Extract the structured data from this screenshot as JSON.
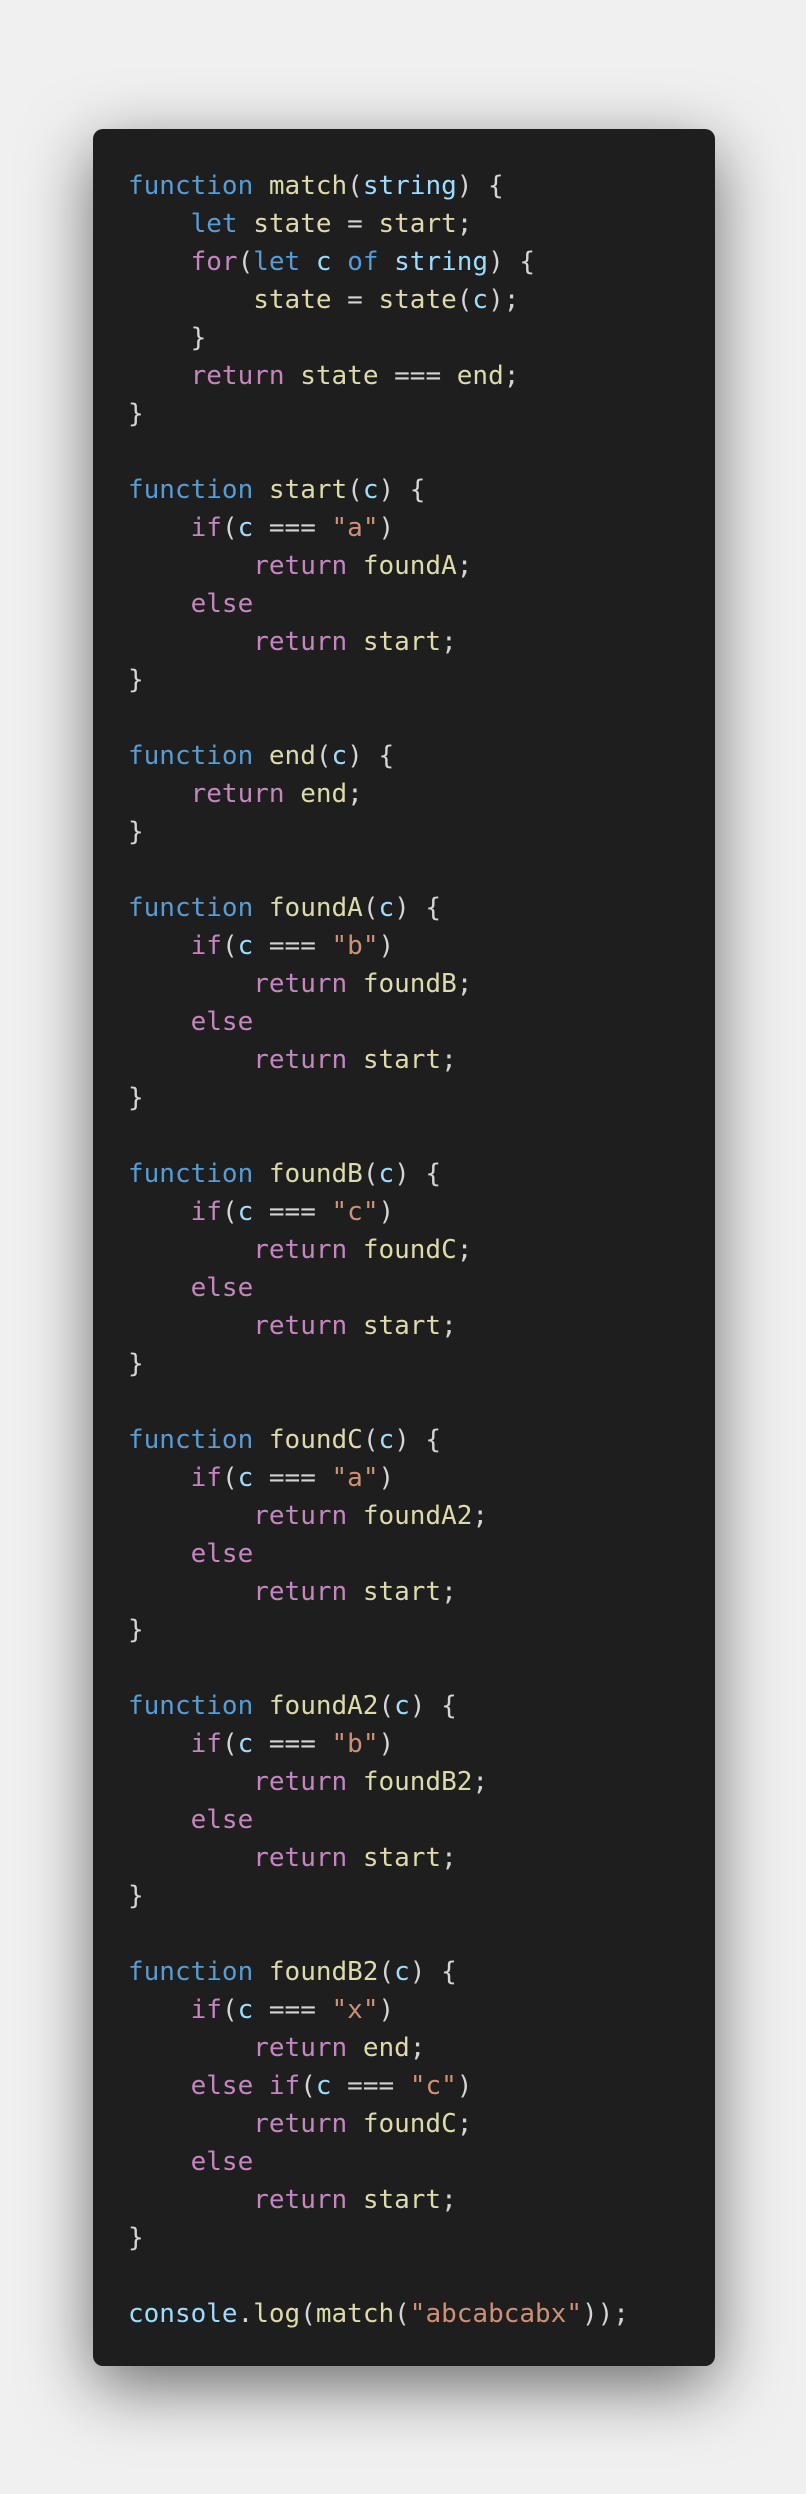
{
  "colors": {
    "background": "#f0f0f0",
    "editor_background": "#1e1e1e",
    "keyword": "#569cd6",
    "control": "#c586c0",
    "function": "#dcdcaa",
    "variable": "#9cdcfe",
    "string": "#ce9178",
    "punctuation": "#d4d4d4"
  },
  "code": {
    "lines": [
      [
        {
          "t": "function",
          "c": "kw"
        },
        {
          "t": " ",
          "c": "pun"
        },
        {
          "t": "match",
          "c": "fn"
        },
        {
          "t": "(",
          "c": "pun"
        },
        {
          "t": "string",
          "c": "var"
        },
        {
          "t": ") {",
          "c": "pun"
        }
      ],
      [
        {
          "t": "    ",
          "c": "pun"
        },
        {
          "t": "let",
          "c": "kw"
        },
        {
          "t": " ",
          "c": "pun"
        },
        {
          "t": "state",
          "c": "fn"
        },
        {
          "t": " = ",
          "c": "pun"
        },
        {
          "t": "start",
          "c": "fn"
        },
        {
          "t": ";",
          "c": "pun"
        }
      ],
      [
        {
          "t": "    ",
          "c": "pun"
        },
        {
          "t": "for",
          "c": "ctl"
        },
        {
          "t": "(",
          "c": "pun"
        },
        {
          "t": "let",
          "c": "kw"
        },
        {
          "t": " ",
          "c": "pun"
        },
        {
          "t": "c",
          "c": "var"
        },
        {
          "t": " ",
          "c": "pun"
        },
        {
          "t": "of",
          "c": "kw"
        },
        {
          "t": " ",
          "c": "pun"
        },
        {
          "t": "string",
          "c": "var"
        },
        {
          "t": ") {",
          "c": "pun"
        }
      ],
      [
        {
          "t": "        ",
          "c": "pun"
        },
        {
          "t": "state",
          "c": "fn"
        },
        {
          "t": " = ",
          "c": "pun"
        },
        {
          "t": "state",
          "c": "fn"
        },
        {
          "t": "(",
          "c": "pun"
        },
        {
          "t": "c",
          "c": "var"
        },
        {
          "t": ");",
          "c": "pun"
        }
      ],
      [
        {
          "t": "    }",
          "c": "pun"
        }
      ],
      [
        {
          "t": "    ",
          "c": "pun"
        },
        {
          "t": "return",
          "c": "ctl"
        },
        {
          "t": " ",
          "c": "pun"
        },
        {
          "t": "state",
          "c": "fn"
        },
        {
          "t": " === ",
          "c": "pun"
        },
        {
          "t": "end",
          "c": "fn"
        },
        {
          "t": ";",
          "c": "pun"
        }
      ],
      [
        {
          "t": "}",
          "c": "pun"
        }
      ],
      [],
      [
        {
          "t": "function",
          "c": "kw"
        },
        {
          "t": " ",
          "c": "pun"
        },
        {
          "t": "start",
          "c": "fn"
        },
        {
          "t": "(",
          "c": "pun"
        },
        {
          "t": "c",
          "c": "var"
        },
        {
          "t": ") {",
          "c": "pun"
        }
      ],
      [
        {
          "t": "    ",
          "c": "pun"
        },
        {
          "t": "if",
          "c": "ctl"
        },
        {
          "t": "(",
          "c": "pun"
        },
        {
          "t": "c",
          "c": "var"
        },
        {
          "t": " === ",
          "c": "pun"
        },
        {
          "t": "\"a\"",
          "c": "str"
        },
        {
          "t": ")",
          "c": "pun"
        }
      ],
      [
        {
          "t": "        ",
          "c": "pun"
        },
        {
          "t": "return",
          "c": "ctl"
        },
        {
          "t": " ",
          "c": "pun"
        },
        {
          "t": "foundA",
          "c": "fn"
        },
        {
          "t": ";",
          "c": "pun"
        }
      ],
      [
        {
          "t": "    ",
          "c": "pun"
        },
        {
          "t": "else",
          "c": "ctl"
        }
      ],
      [
        {
          "t": "        ",
          "c": "pun"
        },
        {
          "t": "return",
          "c": "ctl"
        },
        {
          "t": " ",
          "c": "pun"
        },
        {
          "t": "start",
          "c": "fn"
        },
        {
          "t": ";",
          "c": "pun"
        }
      ],
      [
        {
          "t": "}",
          "c": "pun"
        }
      ],
      [],
      [
        {
          "t": "function",
          "c": "kw"
        },
        {
          "t": " ",
          "c": "pun"
        },
        {
          "t": "end",
          "c": "fn"
        },
        {
          "t": "(",
          "c": "pun"
        },
        {
          "t": "c",
          "c": "var"
        },
        {
          "t": ") {",
          "c": "pun"
        }
      ],
      [
        {
          "t": "    ",
          "c": "pun"
        },
        {
          "t": "return",
          "c": "ctl"
        },
        {
          "t": " ",
          "c": "pun"
        },
        {
          "t": "end",
          "c": "fn"
        },
        {
          "t": ";",
          "c": "pun"
        }
      ],
      [
        {
          "t": "}",
          "c": "pun"
        }
      ],
      [],
      [
        {
          "t": "function",
          "c": "kw"
        },
        {
          "t": " ",
          "c": "pun"
        },
        {
          "t": "foundA",
          "c": "fn"
        },
        {
          "t": "(",
          "c": "pun"
        },
        {
          "t": "c",
          "c": "var"
        },
        {
          "t": ") {",
          "c": "pun"
        }
      ],
      [
        {
          "t": "    ",
          "c": "pun"
        },
        {
          "t": "if",
          "c": "ctl"
        },
        {
          "t": "(",
          "c": "pun"
        },
        {
          "t": "c",
          "c": "var"
        },
        {
          "t": " === ",
          "c": "pun"
        },
        {
          "t": "\"b\"",
          "c": "str"
        },
        {
          "t": ")",
          "c": "pun"
        }
      ],
      [
        {
          "t": "        ",
          "c": "pun"
        },
        {
          "t": "return",
          "c": "ctl"
        },
        {
          "t": " ",
          "c": "pun"
        },
        {
          "t": "foundB",
          "c": "fn"
        },
        {
          "t": ";",
          "c": "pun"
        }
      ],
      [
        {
          "t": "    ",
          "c": "pun"
        },
        {
          "t": "else",
          "c": "ctl"
        }
      ],
      [
        {
          "t": "        ",
          "c": "pun"
        },
        {
          "t": "return",
          "c": "ctl"
        },
        {
          "t": " ",
          "c": "pun"
        },
        {
          "t": "start",
          "c": "fn"
        },
        {
          "t": ";",
          "c": "pun"
        }
      ],
      [
        {
          "t": "}",
          "c": "pun"
        }
      ],
      [],
      [
        {
          "t": "function",
          "c": "kw"
        },
        {
          "t": " ",
          "c": "pun"
        },
        {
          "t": "foundB",
          "c": "fn"
        },
        {
          "t": "(",
          "c": "pun"
        },
        {
          "t": "c",
          "c": "var"
        },
        {
          "t": ") {",
          "c": "pun"
        }
      ],
      [
        {
          "t": "    ",
          "c": "pun"
        },
        {
          "t": "if",
          "c": "ctl"
        },
        {
          "t": "(",
          "c": "pun"
        },
        {
          "t": "c",
          "c": "var"
        },
        {
          "t": " === ",
          "c": "pun"
        },
        {
          "t": "\"c\"",
          "c": "str"
        },
        {
          "t": ")",
          "c": "pun"
        }
      ],
      [
        {
          "t": "        ",
          "c": "pun"
        },
        {
          "t": "return",
          "c": "ctl"
        },
        {
          "t": " ",
          "c": "pun"
        },
        {
          "t": "foundC",
          "c": "fn"
        },
        {
          "t": ";",
          "c": "pun"
        }
      ],
      [
        {
          "t": "    ",
          "c": "pun"
        },
        {
          "t": "else",
          "c": "ctl"
        }
      ],
      [
        {
          "t": "        ",
          "c": "pun"
        },
        {
          "t": "return",
          "c": "ctl"
        },
        {
          "t": " ",
          "c": "pun"
        },
        {
          "t": "start",
          "c": "fn"
        },
        {
          "t": ";",
          "c": "pun"
        }
      ],
      [
        {
          "t": "}",
          "c": "pun"
        }
      ],
      [],
      [
        {
          "t": "function",
          "c": "kw"
        },
        {
          "t": " ",
          "c": "pun"
        },
        {
          "t": "foundC",
          "c": "fn"
        },
        {
          "t": "(",
          "c": "pun"
        },
        {
          "t": "c",
          "c": "var"
        },
        {
          "t": ") {",
          "c": "pun"
        }
      ],
      [
        {
          "t": "    ",
          "c": "pun"
        },
        {
          "t": "if",
          "c": "ctl"
        },
        {
          "t": "(",
          "c": "pun"
        },
        {
          "t": "c",
          "c": "var"
        },
        {
          "t": " === ",
          "c": "pun"
        },
        {
          "t": "\"a\"",
          "c": "str"
        },
        {
          "t": ")",
          "c": "pun"
        }
      ],
      [
        {
          "t": "        ",
          "c": "pun"
        },
        {
          "t": "return",
          "c": "ctl"
        },
        {
          "t": " ",
          "c": "pun"
        },
        {
          "t": "foundA2",
          "c": "fn"
        },
        {
          "t": ";",
          "c": "pun"
        }
      ],
      [
        {
          "t": "    ",
          "c": "pun"
        },
        {
          "t": "else",
          "c": "ctl"
        }
      ],
      [
        {
          "t": "        ",
          "c": "pun"
        },
        {
          "t": "return",
          "c": "ctl"
        },
        {
          "t": " ",
          "c": "pun"
        },
        {
          "t": "start",
          "c": "fn"
        },
        {
          "t": ";",
          "c": "pun"
        }
      ],
      [
        {
          "t": "}",
          "c": "pun"
        }
      ],
      [],
      [
        {
          "t": "function",
          "c": "kw"
        },
        {
          "t": " ",
          "c": "pun"
        },
        {
          "t": "foundA2",
          "c": "fn"
        },
        {
          "t": "(",
          "c": "pun"
        },
        {
          "t": "c",
          "c": "var"
        },
        {
          "t": ") {",
          "c": "pun"
        }
      ],
      [
        {
          "t": "    ",
          "c": "pun"
        },
        {
          "t": "if",
          "c": "ctl"
        },
        {
          "t": "(",
          "c": "pun"
        },
        {
          "t": "c",
          "c": "var"
        },
        {
          "t": " === ",
          "c": "pun"
        },
        {
          "t": "\"b\"",
          "c": "str"
        },
        {
          "t": ")",
          "c": "pun"
        }
      ],
      [
        {
          "t": "        ",
          "c": "pun"
        },
        {
          "t": "return",
          "c": "ctl"
        },
        {
          "t": " ",
          "c": "pun"
        },
        {
          "t": "foundB2",
          "c": "fn"
        },
        {
          "t": ";",
          "c": "pun"
        }
      ],
      [
        {
          "t": "    ",
          "c": "pun"
        },
        {
          "t": "else",
          "c": "ctl"
        }
      ],
      [
        {
          "t": "        ",
          "c": "pun"
        },
        {
          "t": "return",
          "c": "ctl"
        },
        {
          "t": " ",
          "c": "pun"
        },
        {
          "t": "start",
          "c": "fn"
        },
        {
          "t": ";",
          "c": "pun"
        }
      ],
      [
        {
          "t": "}",
          "c": "pun"
        }
      ],
      [],
      [
        {
          "t": "function",
          "c": "kw"
        },
        {
          "t": " ",
          "c": "pun"
        },
        {
          "t": "foundB2",
          "c": "fn"
        },
        {
          "t": "(",
          "c": "pun"
        },
        {
          "t": "c",
          "c": "var"
        },
        {
          "t": ") {",
          "c": "pun"
        }
      ],
      [
        {
          "t": "    ",
          "c": "pun"
        },
        {
          "t": "if",
          "c": "ctl"
        },
        {
          "t": "(",
          "c": "pun"
        },
        {
          "t": "c",
          "c": "var"
        },
        {
          "t": " === ",
          "c": "pun"
        },
        {
          "t": "\"x\"",
          "c": "str"
        },
        {
          "t": ")",
          "c": "pun"
        }
      ],
      [
        {
          "t": "        ",
          "c": "pun"
        },
        {
          "t": "return",
          "c": "ctl"
        },
        {
          "t": " ",
          "c": "pun"
        },
        {
          "t": "end",
          "c": "fn"
        },
        {
          "t": ";",
          "c": "pun"
        }
      ],
      [
        {
          "t": "    ",
          "c": "pun"
        },
        {
          "t": "else",
          "c": "ctl"
        },
        {
          "t": " ",
          "c": "pun"
        },
        {
          "t": "if",
          "c": "ctl"
        },
        {
          "t": "(",
          "c": "pun"
        },
        {
          "t": "c",
          "c": "var"
        },
        {
          "t": " === ",
          "c": "pun"
        },
        {
          "t": "\"c\"",
          "c": "str"
        },
        {
          "t": ")",
          "c": "pun"
        }
      ],
      [
        {
          "t": "        ",
          "c": "pun"
        },
        {
          "t": "return",
          "c": "ctl"
        },
        {
          "t": " ",
          "c": "pun"
        },
        {
          "t": "foundC",
          "c": "fn"
        },
        {
          "t": ";",
          "c": "pun"
        }
      ],
      [
        {
          "t": "    ",
          "c": "pun"
        },
        {
          "t": "else",
          "c": "ctl"
        }
      ],
      [
        {
          "t": "        ",
          "c": "pun"
        },
        {
          "t": "return",
          "c": "ctl"
        },
        {
          "t": " ",
          "c": "pun"
        },
        {
          "t": "start",
          "c": "fn"
        },
        {
          "t": ";",
          "c": "pun"
        }
      ],
      [
        {
          "t": "}",
          "c": "pun"
        }
      ],
      [],
      [
        {
          "t": "console",
          "c": "var"
        },
        {
          "t": ".",
          "c": "pun"
        },
        {
          "t": "log",
          "c": "fn"
        },
        {
          "t": "(",
          "c": "pun"
        },
        {
          "t": "match",
          "c": "fn"
        },
        {
          "t": "(",
          "c": "pun"
        },
        {
          "t": "\"abcabcabx\"",
          "c": "str"
        },
        {
          "t": "));",
          "c": "pun"
        }
      ]
    ]
  }
}
